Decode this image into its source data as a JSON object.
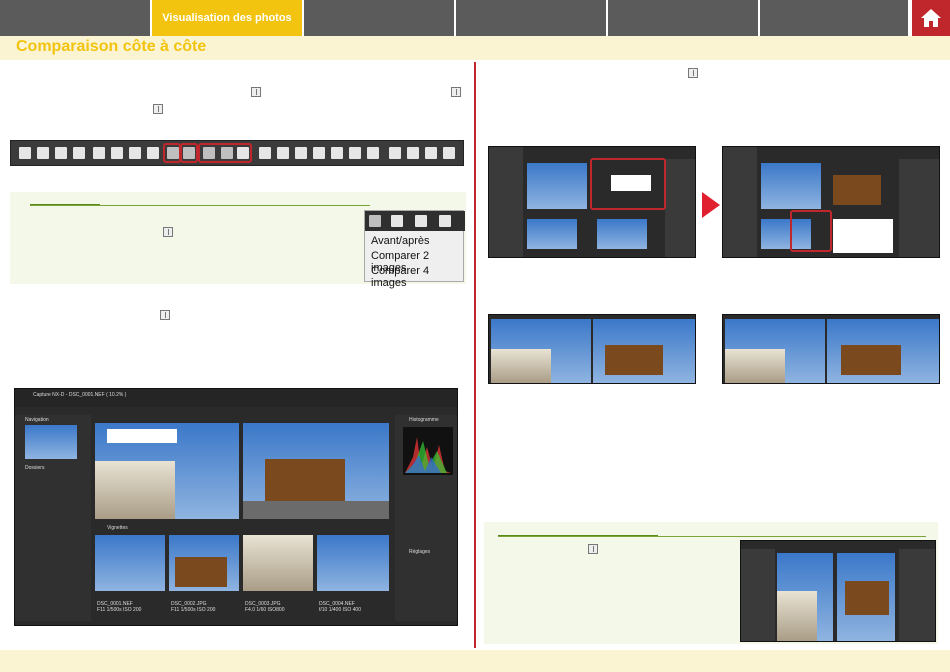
{
  "nav": {
    "active_tab": "Visualisation des photos",
    "home_icon": "home-icon"
  },
  "page_title": "Comparaison côte à côte",
  "menu": {
    "items": [
      "Avant/après",
      "Comparer 2 images",
      "Comparer 4 images"
    ]
  },
  "screenshot": {
    "window_title": "Capture NX-D - DSC_0001.NEF ( 10.2% )",
    "panels": {
      "navigation": "Navigation",
      "histogram": "Histogramme",
      "folders": "Dossiers",
      "thumbnails": "Vignettes",
      "settings": "Réglages"
    },
    "thumbs": [
      {
        "name": "DSC_0001.NEF",
        "info": "F11 1/500s ISO 200"
      },
      {
        "name": "DSC_0002.JPG",
        "info": "F11 1/500s ISO 200"
      },
      {
        "name": "DSC_0003.JPG",
        "info": "F4.0 1/60 ISO800"
      },
      {
        "name": "DSC_0004.NEF",
        "info": "f/10 1/400 ISO 400"
      }
    ]
  },
  "colors": {
    "nav_bg": "#5b5b5b",
    "nav_active": "#f2c30f",
    "home_bg": "#c0272d",
    "title_bg": "#fbf4d2",
    "accent_red": "#c0272d",
    "note_bg": "#f3f8e9"
  }
}
